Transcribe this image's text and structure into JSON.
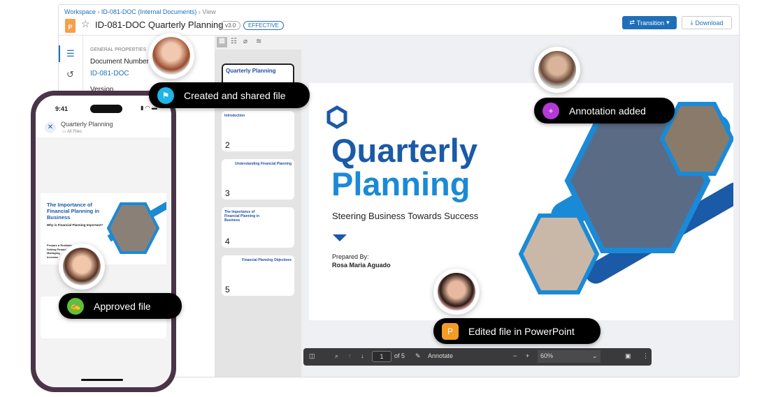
{
  "breadcrumb": [
    "Workspace",
    "ID-081-DOC (Internal Documents)",
    "View"
  ],
  "title": "ID-081-DOC Quarterly Planning",
  "version": "v3.0",
  "status": "EFFECTIVE",
  "buttons": {
    "transition": "Transition",
    "download": "Download"
  },
  "properties": {
    "section": "GENERAL PROPERTIES",
    "doc_number_label": "Document Number",
    "doc_number": "ID-081-DOC",
    "version_label": "Version"
  },
  "thumbnails": [
    {
      "num": "",
      "title": "Quarterly Planning"
    },
    {
      "num": "2",
      "title": "Introduction"
    },
    {
      "num": "3",
      "title": "Understanding Financial Planning"
    },
    {
      "num": "4",
      "title": "The Importance of Financial Planning in Business"
    },
    {
      "num": "5",
      "title": "Financial Planning Objectives"
    }
  ],
  "slide": {
    "title1": "Quarterly",
    "title2": "Planning",
    "subtitle": "Steering Business Towards Success",
    "prepared_label": "Prepared By:",
    "prepared_name": "Rosa Maria Aguado"
  },
  "toolbar": {
    "page": "1",
    "of": "of 5",
    "annotate": "Annotate",
    "zoom": "60%"
  },
  "phone": {
    "time": "9:41",
    "title": "Quarterly Planning",
    "folder": "All Files",
    "slide_title": "The Importance of Financial Planning in Business",
    "slide_sub": "Why is Financial Planning Important?",
    "bullets": [
      "Prepare a Realistic",
      "Setting Financial",
      "Managing",
      "Increase"
    ]
  },
  "badges": {
    "created": "Created and shared file",
    "annotation": "Annotation added",
    "edited": "Edited file in PowerPoint",
    "approved": "Approved file"
  },
  "colors": {
    "accent": "#1f6fb8",
    "slide_blue": "#1b5aa6",
    "created": "#1fb5e8",
    "annotation": "#b43ad6",
    "edited": "#f29b25",
    "approved": "#5cc236"
  }
}
